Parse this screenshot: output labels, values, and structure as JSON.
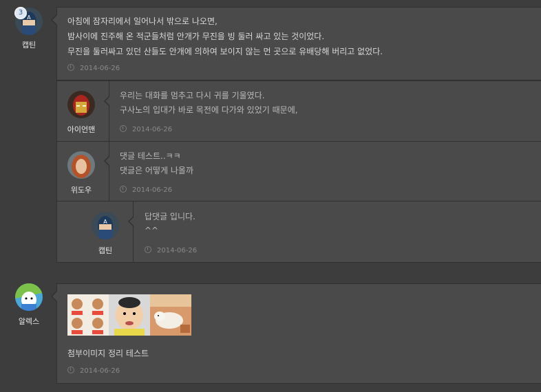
{
  "comments": [
    {
      "author": "캡틴",
      "badge": "3",
      "lines": [
        "아침에 잠자리에서 일어나서 밖으로 나오면,",
        "밤사이에 진주해 온 적군들처럼 안개가 무진을 빙 둘러 싸고 있는 것이었다.",
        "무진을 둘러싸고 있던 산들도 안개에 의하여 보이지 않는 먼 곳으로 유배당해 버리고 없었다."
      ],
      "date": "2014-06-26"
    },
    {
      "author": "아이언맨",
      "lines": [
        "우리는 대화를 멈추고 다시 귀를 기울였다.",
        "구사노의 입대가 바로 목전에 다가와 있었기 때문에,"
      ],
      "date": "2014-06-26"
    },
    {
      "author": "위도우",
      "lines": [
        "댓글 테스트..ㅋㅋ",
        "댓글은 어떻게 나올까"
      ],
      "date": "2014-06-26"
    },
    {
      "author": "캡틴",
      "lines": [
        "답댓글 입니다.",
        "^^"
      ],
      "date": "2014-06-26"
    },
    {
      "author": "알렉스",
      "lines": [
        "첨부이미지 정리 테스트"
      ],
      "date": "2014-06-26",
      "attachments": [
        "sticker-image",
        "baby-image",
        "dog-image"
      ]
    }
  ],
  "colors": {
    "background": "#3c3d3c",
    "panel": "#494a49",
    "border": "#2f302f",
    "text": "#d8d8d8",
    "meta": "#8a8a8a"
  }
}
